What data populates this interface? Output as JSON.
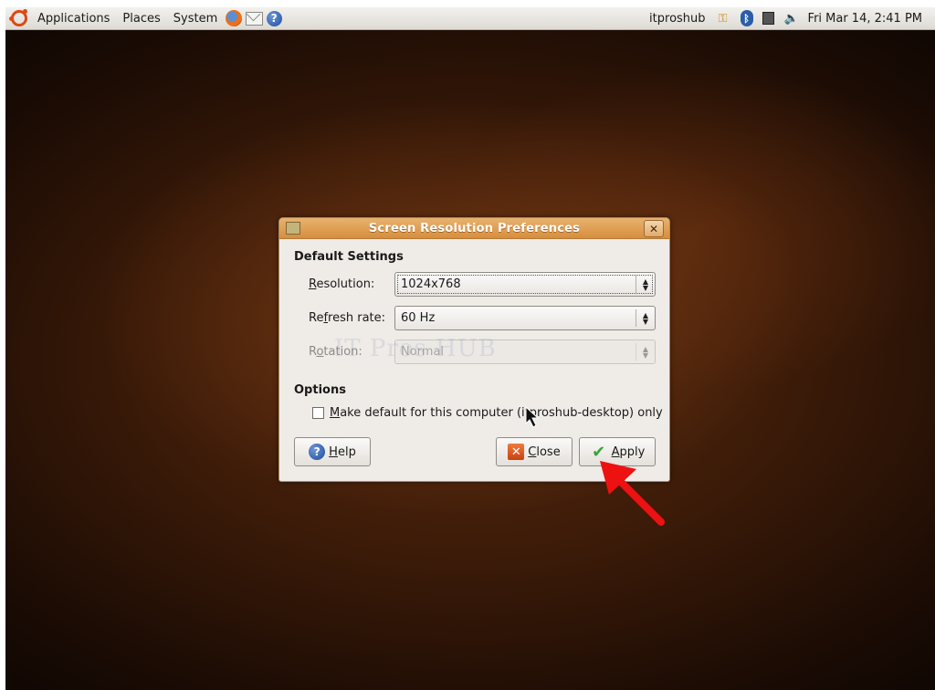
{
  "top_panel": {
    "menus": [
      "Applications",
      "Places",
      "System"
    ],
    "user": "itproshub",
    "clock": "Fri Mar 14,  2:41 PM"
  },
  "dialog": {
    "title": "Screen Resolution Preferences",
    "default_settings_title": "Default Settings",
    "resolution": {
      "label_mnemonic": "R",
      "label_rest": "esolution:",
      "value": "1024x768"
    },
    "refresh_rate": {
      "label_pre": "Re",
      "label_mnemonic": "f",
      "label_rest": "resh rate:",
      "value": "60 Hz"
    },
    "rotation": {
      "label_pre": "R",
      "label_mnemonic": "o",
      "label_rest": "tation:",
      "value": "Normal"
    },
    "watermark": "IT Pros HUB",
    "options_title": "Options",
    "make_default": {
      "mnemonic": "M",
      "rest": "ake default for this computer (itproshub-desktop) only",
      "checked": false
    },
    "buttons": {
      "help": {
        "mnemonic": "H",
        "rest": "elp"
      },
      "close": {
        "mnemonic": "C",
        "rest": "lose"
      },
      "apply": {
        "mnemonic": "A",
        "rest": "pply"
      }
    }
  }
}
